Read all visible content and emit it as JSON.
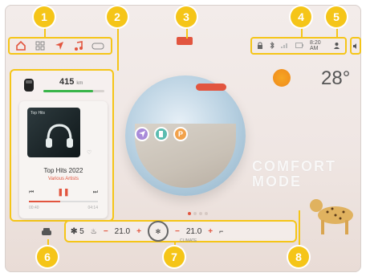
{
  "colors": {
    "accent": "#e2553f",
    "callout": "#f5c518",
    "range_green": "#3ab54a"
  },
  "callouts": [
    "1",
    "2",
    "3",
    "4",
    "5",
    "6",
    "7",
    "8"
  ],
  "top_bar": {
    "nav_icons": [
      "home-icon",
      "grid-icon",
      "navigation-icon",
      "music-icon",
      "app-icon"
    ],
    "status": {
      "time": "8:20 AM",
      "icons": [
        "lock-icon",
        "bluetooth-icon",
        "signal-icon",
        "battery-icon",
        "user-icon"
      ]
    },
    "volume_icon": "volume-icon"
  },
  "left_panel": {
    "range": {
      "value": "415",
      "unit": "km",
      "fill_fraction": 0.82
    },
    "media": {
      "album_label": "Top Hits",
      "track_title": "Top Hits 2022",
      "artist": "Various Artists",
      "progress_fraction": 0.45,
      "time_elapsed": "00:40",
      "time_total": "04:14"
    }
  },
  "globe": {
    "pois": [
      "P"
    ]
  },
  "weather": {
    "temperature": "28°"
  },
  "comfort_mode": {
    "line1": "COMFORT",
    "line2": "MODE"
  },
  "climate": {
    "fan_speed": "5",
    "left_temp": "21.0",
    "right_temp": "21.0",
    "minus": "−",
    "plus": "+",
    "label": "CLIMATE"
  }
}
